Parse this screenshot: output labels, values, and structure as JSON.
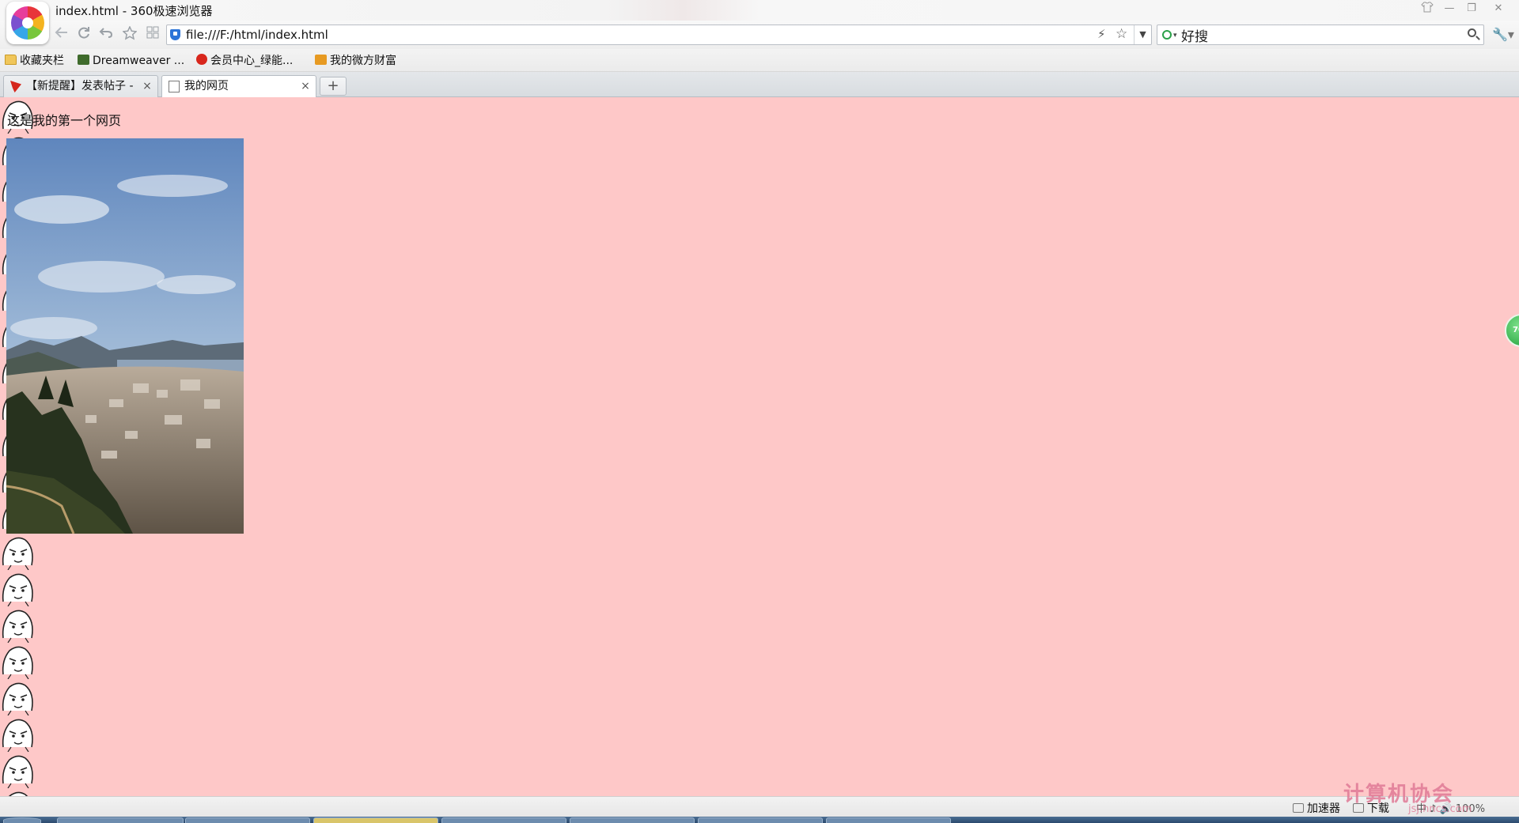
{
  "window": {
    "title": "index.html - 360极速浏览器",
    "controls": {
      "skin": "skin-icon",
      "minimize": "—",
      "maximize": "❐",
      "close": "✕"
    }
  },
  "toolbar": {
    "back_icon": "arrow-left-icon",
    "refresh_icon": "refresh-icon",
    "forward_icon": "undo-icon",
    "home_icon": "star-outline-icon",
    "apps_icon": "grid-icon",
    "address": "file:///F:/html/index.html",
    "search_value": "好搜"
  },
  "bookmarks": [
    {
      "label": "收藏夹栏",
      "icon": "folder-icon"
    },
    {
      "label": "Dreamweaver ...",
      "icon": "dreamweaver-icon"
    },
    {
      "label": "会员中心_绿能...",
      "icon": "weibo-icon"
    },
    {
      "label": "我的微方财富",
      "icon": "wealth-icon"
    }
  ],
  "tabs": [
    {
      "label": "【新提醒】发表帖子 -",
      "active": false
    },
    {
      "label": "我的网页",
      "active": true
    }
  ],
  "page": {
    "background_color": "#fec8c8",
    "text": "这是我的第一个网页"
  },
  "status": {
    "accelerator": "加速器",
    "download": "下载",
    "extra": "中 ♪ 🔊 100%",
    "watermark_text": "计算机协会",
    "watermark_url": "jsj.hncs.com"
  }
}
